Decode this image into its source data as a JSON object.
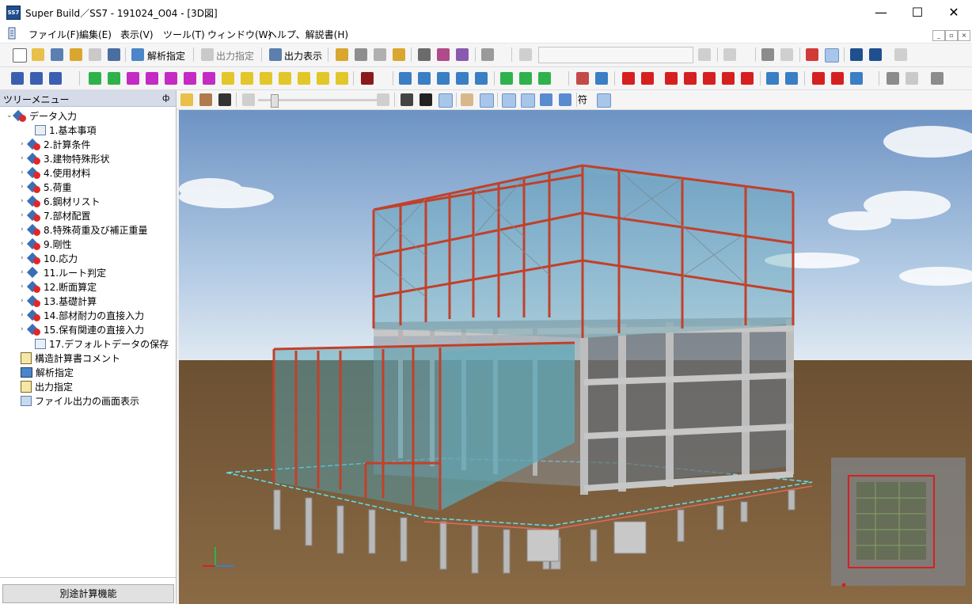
{
  "window": {
    "title": "Super Build／SS7 - 191024_O04 - [3D図]",
    "app_icon_text": "SS7",
    "minimize_glyph": "—",
    "maximize_glyph": "☐",
    "close_glyph": "✕"
  },
  "menu": {
    "items": [
      "ファイル(F)",
      "編集(E)",
      "表示(V)",
      "ツール(T)",
      "ウィンドウ(W)",
      "ヘルプ、解説書(H)"
    ],
    "mdi": [
      "_",
      "▫",
      "×"
    ]
  },
  "toolbar1": {
    "analysis_label": "解析指定",
    "output_spec_label": "出力指定",
    "output_view_label": "出力表示"
  },
  "toolbar3": {
    "symbol_label": "符"
  },
  "tree": {
    "title": "ツリーメニュー",
    "pin": "ф",
    "root_label": "データ入力",
    "children": [
      "1.基本事項",
      "2.計算条件",
      "3.建物特殊形状",
      "4.使用材料",
      "5.荷重",
      "6.鋼材リスト",
      "7.部材配置",
      "8.特殊荷重及び補正重量",
      "9.剛性",
      "10.応力",
      "11.ルート判定",
      "12.断面算定",
      "13.基礎計算",
      "14.部材耐力の直接入力",
      "15.保有関連の直接入力",
      "17.デフォルトデータの保存"
    ],
    "top_items": [
      "構造計算書コメント",
      "解析指定",
      "出力指定",
      "ファイル出力の画面表示"
    ],
    "bottom_button": "別途計算機能"
  },
  "colors": {
    "accent_red": "#c2402a",
    "glass": "#4f9fb0",
    "concrete": "#b9b9b9",
    "ground": "#7a5a3a"
  }
}
